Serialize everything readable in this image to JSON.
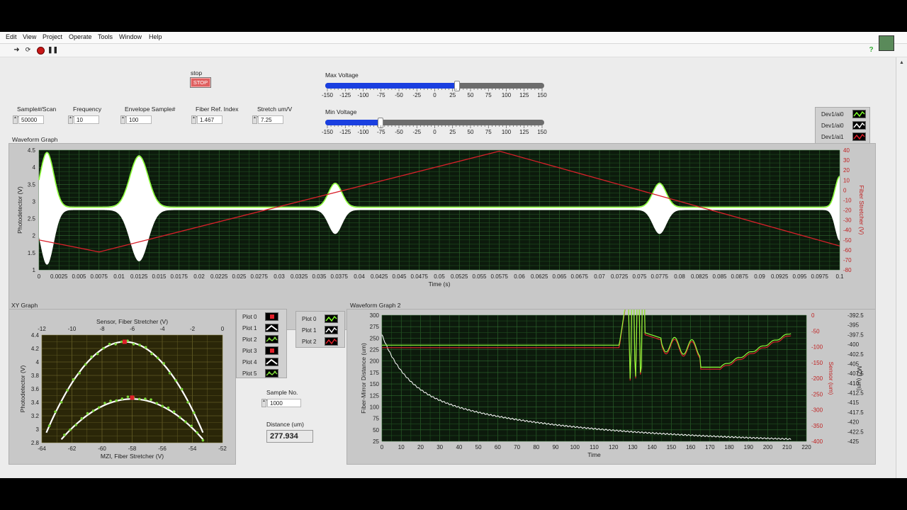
{
  "menu": [
    "Edit",
    "View",
    "Project",
    "Operate",
    "Tools",
    "Window",
    "Help"
  ],
  "toolbar": {
    "run_icon": "run-arrow-icon",
    "run_cont_icon": "run-continuously-icon",
    "abort_icon": "abort-icon",
    "pause_icon": "pause-icon",
    "help_icon": "context-help-icon"
  },
  "stop": {
    "label": "stop",
    "button": "STOP"
  },
  "controls": [
    {
      "label": "Sample#/Scan",
      "value": "50000"
    },
    {
      "label": "Frequency",
      "value": "10"
    },
    {
      "label": "Envelope Sample#",
      "value": "100"
    },
    {
      "label": "Fiber Ref. Index",
      "value": "1.467"
    },
    {
      "label": "Stretch um/V",
      "value": "7.25"
    }
  ],
  "max_voltage": {
    "label": "Max Voltage",
    "value": 30,
    "min": -150,
    "max": 150,
    "ticks": [
      "-150",
      "-125",
      "-100",
      "-75",
      "-50",
      "-25",
      "0",
      "25",
      "50",
      "75",
      "100",
      "125",
      "150"
    ]
  },
  "min_voltage": {
    "label": "Min Voltage",
    "value": -75,
    "min": -150,
    "max": 150,
    "ticks": [
      "-150",
      "-125",
      "-100",
      "-75",
      "-50",
      "-25",
      "0",
      "25",
      "50",
      "75",
      "100",
      "125",
      "150"
    ]
  },
  "top_legend": [
    {
      "name": "Dev1/ai0",
      "color": "#7fff2a"
    },
    {
      "name": "Dev1/ai0",
      "color": "#ffffff"
    },
    {
      "name": "Dev1/ai1",
      "color": "#e0202a"
    }
  ],
  "waveform_graph": {
    "title": "Waveform Graph",
    "xlabel": "Time (s)",
    "ylabel": "Photodetector (V)",
    "y2label": "Fiber Stretcher (V)",
    "xticks": [
      "0",
      "0.0025",
      "0.005",
      "0.0075",
      "0.01",
      "0.0125",
      "0.015",
      "0.0175",
      "0.02",
      "0.0225",
      "0.025",
      "0.0275",
      "0.03",
      "0.0325",
      "0.035",
      "0.0375",
      "0.04",
      "0.0425",
      "0.045",
      "0.0475",
      "0.05",
      "0.0525",
      "0.055",
      "0.0575",
      "0.06",
      "0.0625",
      "0.065",
      "0.0675",
      "0.07",
      "0.0725",
      "0.075",
      "0.0775",
      "0.08",
      "0.0825",
      "0.085",
      "0.0875",
      "0.09",
      "0.0925",
      "0.095",
      "0.0975",
      "0.1"
    ],
    "yticks": [
      "4.5",
      "4",
      "3.5",
      "3",
      "2.5",
      "2",
      "1.5",
      "1"
    ],
    "y2ticks": [
      "40",
      "30",
      "20",
      "10",
      "0",
      "-10",
      "-20",
      "-30",
      "-40",
      "-50",
      "-60",
      "-70",
      "-80"
    ]
  },
  "xy_graph": {
    "title": "XY Graph",
    "top_axis_label": "Sensor, Fiber Stretcher (V)",
    "xlabel": "MZI, Fiber Stretcher (V)",
    "ylabel": "Photodetector (V)",
    "top_ticks": [
      "-12",
      "-10",
      "-8",
      "-6",
      "-4",
      "-2",
      "0"
    ],
    "xticks": [
      "-64",
      "-62",
      "-60",
      "-58",
      "-56",
      "-54",
      "-52"
    ],
    "yticks": [
      "4.4",
      "4.2",
      "4",
      "3.8",
      "3.6",
      "3.4",
      "3.2",
      "3",
      "2.8"
    ]
  },
  "xy_legend": [
    "Plot 0",
    "Plot 1",
    "Plot 2",
    "Plot 3",
    "Plot 4",
    "Plot 5"
  ],
  "wf2_legend": [
    "Plot 0",
    "Plot 1",
    "Plot 2"
  ],
  "sample_no": {
    "label": "Sample No.",
    "value": "1000"
  },
  "distance": {
    "label": "Distance (um)",
    "value": "277.934"
  },
  "waveform_graph2": {
    "title": "Waveform Graph 2",
    "xlabel": "Time",
    "ylabel": "Fiber-Mirror Distance (um)",
    "y2label": "Sensor (um)",
    "y3label": "MZI (um)",
    "xticks": [
      "0",
      "10",
      "20",
      "30",
      "40",
      "50",
      "60",
      "70",
      "80",
      "90",
      "100",
      "110",
      "120",
      "130",
      "140",
      "150",
      "160",
      "170",
      "180",
      "190",
      "200",
      "210",
      "220"
    ],
    "yticks": [
      "300",
      "275",
      "250",
      "225",
      "200",
      "175",
      "150",
      "125",
      "100",
      "75",
      "50",
      "25"
    ],
    "y2ticks": [
      "0",
      "-50",
      "-100",
      "-150",
      "-200",
      "-250",
      "-300",
      "-350",
      "-400"
    ],
    "y3ticks": [
      "-392.5",
      "-395",
      "-397.5",
      "-400",
      "-402.5",
      "-405",
      "-407.5",
      "-410",
      "-412.5",
      "-415",
      "-417.5",
      "-420",
      "-422.5",
      "-425"
    ]
  }
}
